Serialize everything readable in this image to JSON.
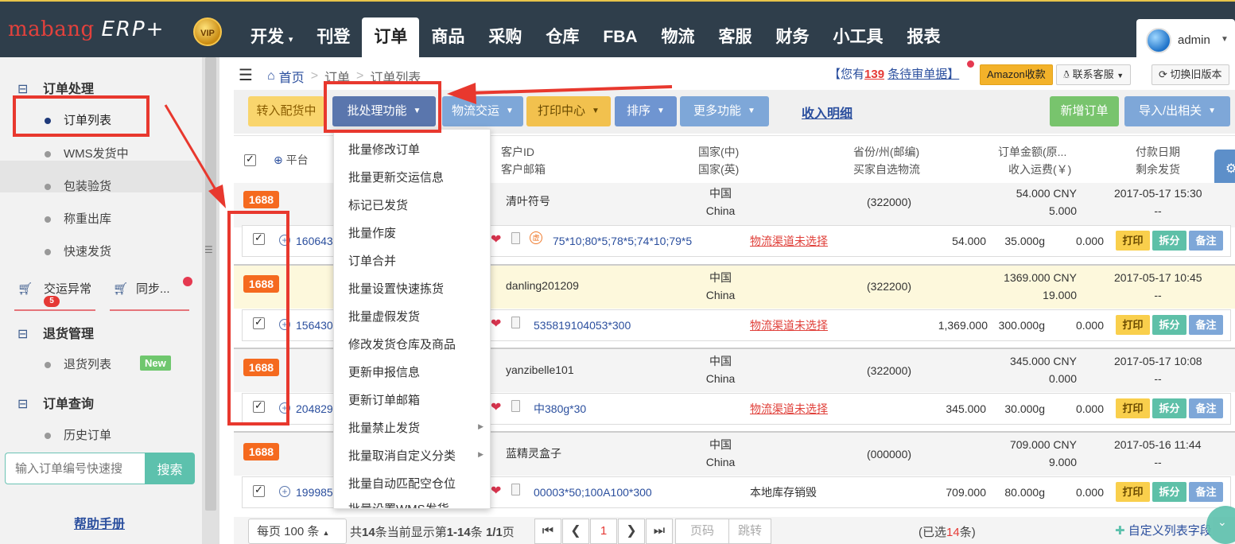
{
  "topnav": {
    "logo": "mabang",
    "logo_suffix": "ERP+",
    "vip": "VIP",
    "items": [
      "开发",
      "刊登",
      "订单",
      "商品",
      "采购",
      "仓库",
      "FBA",
      "物流",
      "客服",
      "财务",
      "小工具",
      "报表"
    ],
    "active": "订单",
    "user": "admin"
  },
  "sidebar": {
    "order_processing": "订单处理",
    "order_list": "订单列表",
    "wms_shipping": "WMS发货中",
    "pack_check": "包装验货",
    "weigh_out": "称重出库",
    "quick_ship": "快速发货",
    "transport_exception": "交运异常",
    "transport_exception_count": "5",
    "sync": "同步...",
    "return_mgmt": "退货管理",
    "return_list": "退货列表",
    "new_badge": "New",
    "order_query": "订单查询",
    "history_orders": "历史订单",
    "search_placeholder": "输入订单编号快速搜",
    "search_button": "搜索",
    "help": "帮助手册"
  },
  "breadcrumb": {
    "home": "首页",
    "order": "订单",
    "list": "订单列表"
  },
  "header": {
    "pending_prefix": "【您有",
    "pending_count": "139",
    "pending_suffix": "条待审单据】",
    "amazon": "Amazon收款",
    "contact": "联系客服",
    "switch_old": "切换旧版本"
  },
  "toolbar": {
    "transfer": "转入配货中",
    "batch": "批处理功能",
    "logistics": "物流交运",
    "print_center": "打印中心",
    "sort": "排序",
    "more": "更多功能",
    "income": "收入明细",
    "new_order": "新增订单",
    "import_export": "导入/出相关"
  },
  "table_headers": {
    "platform": "平台",
    "customer_id": "客户ID",
    "customer_email": "客户邮箱",
    "country_cn": "国家(中)",
    "country_en": "国家(英)",
    "province": "省份/州(邮编)",
    "buyer_logistics": "买家自选物流",
    "order_amount": "订单金额(原...",
    "shipping_income": "收入运费(￥)",
    "pay_date": "付款日期",
    "remaining": "剩余发货"
  },
  "orders": [
    {
      "platform": "1688",
      "order_no": "160643",
      "customer": "清叶符号",
      "country_cn": "中国",
      "country_en": "China",
      "postcode": "(322000)",
      "amount": "54.000 CNY",
      "shipping": "5.000",
      "date": "2017-05-17 15:30",
      "remaining": "--",
      "items": "75*10;80*5;78*5;74*10;79*5",
      "logistics": "物流渠道未选择",
      "total": "54.000",
      "weight": "35.000g",
      "fee": "0.000"
    },
    {
      "platform": "1688",
      "order_no": "156430",
      "customer": "danling201209",
      "country_cn": "中国",
      "country_en": "China",
      "postcode": "(322200)",
      "amount": "1369.000 CNY",
      "shipping": "19.000",
      "date": "2017-05-17 10:45",
      "remaining": "--",
      "items": "535819104053*300",
      "logistics": "物流渠道未选择",
      "total": "1,369.000",
      "weight": "300.000g",
      "fee": "0.000"
    },
    {
      "platform": "1688",
      "order_no": "204829",
      "customer": "yanzibelle101",
      "country_cn": "中国",
      "country_en": "China",
      "postcode": "(322000)",
      "amount": "345.000 CNY",
      "shipping": "0.000",
      "date": "2017-05-17 10:08",
      "remaining": "--",
      "items": "中380g*30",
      "logistics": "物流渠道未选择",
      "total": "345.000",
      "weight": "30.000g",
      "fee": "0.000"
    },
    {
      "platform": "1688",
      "order_no": "199985",
      "customer": "蓝精灵盒子",
      "country_cn": "中国",
      "country_en": "China",
      "postcode": "(000000)",
      "amount": "709.000 CNY",
      "shipping": "9.000",
      "date": "2017-05-16 11:44",
      "remaining": "--",
      "items": "00003*50;100A100*300",
      "logistics": "本地库存销毁",
      "total": "709.000",
      "weight": "80.000g",
      "fee": "0.000"
    }
  ],
  "row_actions": {
    "print": "打印",
    "split": "拆分",
    "note": "备注"
  },
  "stamp_glyph": "虚",
  "dropdown_items": [
    "批量修改订单",
    "批量更新交运信息",
    "标记已发货",
    "批量作废",
    "订单合并",
    "批量设置快速拣货",
    "批量虚假发货",
    "修改发货仓库及商品",
    "更新申报信息",
    "更新订单邮箱",
    "批量禁止发货",
    "批量取消自定义分类",
    "批量自动匹配空仓位",
    "批量设置WMS发货"
  ],
  "footer": {
    "per_page": "每页 100 条",
    "total_prefix": "共",
    "total_count": "14",
    "total_mid": "条当前显示第",
    "range": "1-14",
    "total_suffix": "条",
    "pages": "1/1",
    "page_word": "页",
    "current_page": "1",
    "page_input": "页码",
    "go": "跳转",
    "selected_prefix": "(已选",
    "selected_count": "14",
    "selected_suffix": "条)",
    "custom_columns": "自定义列表字段"
  },
  "colors": {
    "nav_bg": "#2f3e4b",
    "accent_red": "#e8382e",
    "badge_orange": "#f56a1f",
    "link_blue": "#2b4f9e"
  }
}
